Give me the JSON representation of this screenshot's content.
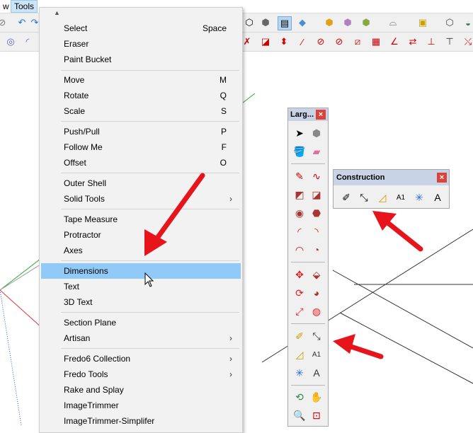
{
  "menubar": {
    "view_label": "w",
    "tools_label": "Tools"
  },
  "menu": {
    "items": [
      {
        "label": "Select",
        "shortcut": "Space"
      },
      {
        "label": "Eraser",
        "shortcut": ""
      },
      {
        "label": "Paint Bucket",
        "shortcut": ""
      },
      {
        "label": "Move",
        "shortcut": "M"
      },
      {
        "label": "Rotate",
        "shortcut": "Q"
      },
      {
        "label": "Scale",
        "shortcut": "S"
      },
      {
        "label": "Push/Pull",
        "shortcut": "P"
      },
      {
        "label": "Follow Me",
        "shortcut": "F"
      },
      {
        "label": "Offset",
        "shortcut": "O"
      },
      {
        "label": "Outer Shell",
        "shortcut": ""
      },
      {
        "label": "Solid Tools",
        "shortcut": "›"
      },
      {
        "label": "Tape Measure",
        "shortcut": ""
      },
      {
        "label": "Protractor",
        "shortcut": ""
      },
      {
        "label": "Axes",
        "shortcut": ""
      },
      {
        "label": "Dimensions",
        "shortcut": ""
      },
      {
        "label": "Text",
        "shortcut": ""
      },
      {
        "label": "3D Text",
        "shortcut": ""
      },
      {
        "label": "Section Plane",
        "shortcut": ""
      },
      {
        "label": "Artisan",
        "shortcut": "›"
      },
      {
        "label": "Fredo6 Collection",
        "shortcut": "›"
      },
      {
        "label": "Fredo Tools",
        "shortcut": "›"
      },
      {
        "label": "Rake and Splay",
        "shortcut": ""
      },
      {
        "label": "ImageTrimmer",
        "shortcut": ""
      },
      {
        "label": "ImageTrimmer-Simplifer",
        "shortcut": ""
      }
    ]
  },
  "large_toolbar": {
    "title": "Larg...",
    "close": "×"
  },
  "construction_toolbar": {
    "title": "Construction",
    "close": "×"
  },
  "colors": {
    "highlight": "#91c9f7",
    "arrow": "#e8141c",
    "close": "#d9433a"
  }
}
